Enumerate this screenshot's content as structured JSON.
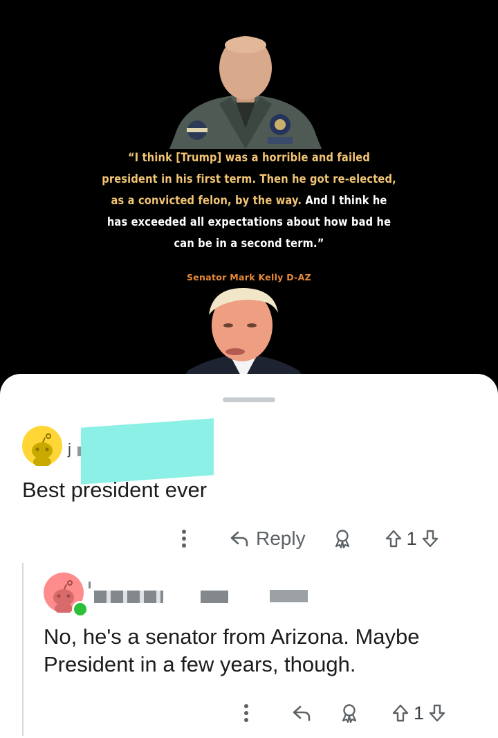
{
  "post": {
    "quote_gold": "“I think [Trump] was a horrible and failed president in his first term. Then he got re-elected, as a convicted felon, by the way.",
    "quote_white": "And I think he has exceeded all expectations about how bad he can be in a second term.”",
    "attribution": "Senator Mark Kelly D-AZ"
  },
  "comments": [
    {
      "username": "j",
      "body": "Best president ever",
      "reply_label": "Reply",
      "vote_count": "1"
    },
    {
      "body": "No, he's a senator from Arizona. Maybe President in a few years, though.",
      "vote_count": "1"
    }
  ],
  "colors": {
    "quote_gold": "#f2c574",
    "attribution_orange": "#e98a3a",
    "avatar_yellow": "#ffd635",
    "avatar_pink": "#ff8c8c",
    "online_green": "#2dbf3a"
  },
  "icons": [
    "more-icon",
    "reply-icon",
    "award-icon",
    "upvote-icon",
    "downvote-icon",
    "snoo-avatar-icon"
  ]
}
